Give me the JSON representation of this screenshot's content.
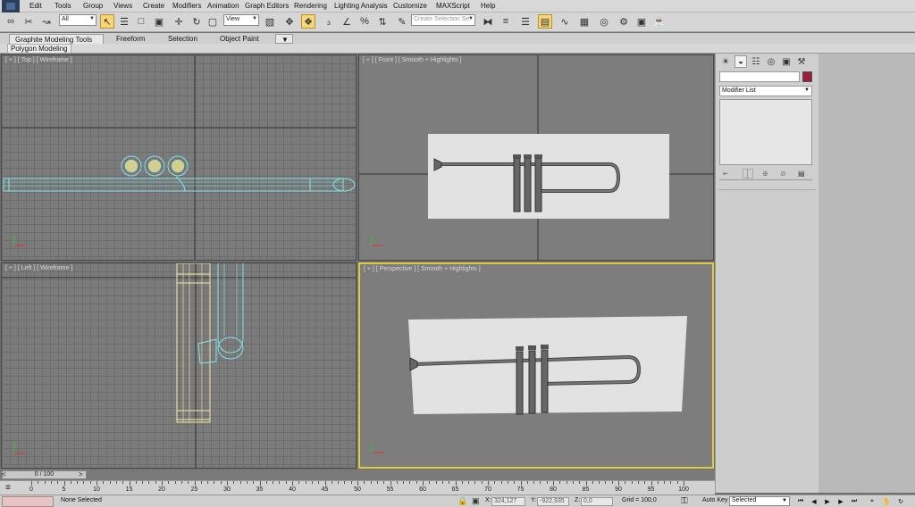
{
  "menu": {
    "items": [
      "Edit",
      "Tools",
      "Group",
      "Views",
      "Create",
      "Modifiers",
      "Animation",
      "Graph Editors",
      "Rendering",
      "Lighting Analysis",
      "Customize",
      "MAXScript",
      "Help"
    ]
  },
  "toolbar": {
    "filter_value": "All",
    "refcoord_value": "View",
    "selection_set_placeholder": "Create Selection Se",
    "icons": [
      "link-icon",
      "unlink-icon",
      "bind-spacewarp-icon",
      "select-object-icon",
      "select-by-name-icon",
      "rect-region-icon",
      "window-crossing-icon",
      "select-move-icon",
      "select-rotate-icon",
      "select-scale-icon",
      "pivot-icon",
      "manipulate-icon",
      "keyboard-shortcut-icon",
      "snap-3d-icon",
      "angle-snap-icon",
      "percent-snap-icon",
      "spinner-snap-icon",
      "edit-named-sel-icon",
      "mirror-icon",
      "align-icon",
      "layer-manager-icon",
      "graphite-toggle-icon",
      "curve-editor-icon",
      "schematic-view-icon",
      "material-editor-icon",
      "render-setup-icon",
      "rendered-frame-icon",
      "render-production-icon",
      "render-iterative-icon"
    ]
  },
  "ribbon": {
    "tabs": [
      "Graphite Modeling Tools",
      "Freeform",
      "Selection",
      "Object Paint"
    ],
    "active_tab": "Graphite Modeling Tools",
    "panel_label": "Polygon Modeling"
  },
  "viewports": {
    "top": {
      "label": "[ + ] [ Top ] [ Wireframe ]"
    },
    "front": {
      "label": "[ + ] [ Front ] [ Smooth + Highlights ]"
    },
    "left": {
      "label": "[ + ] [ Left ] [ Wireframe ]"
    },
    "perspective": {
      "label": "[ + ] [ Perspective ] [ Smooth + Highlights ]"
    }
  },
  "command_panel": {
    "tabs": [
      "create-icon",
      "modify-icon",
      "hierarchy-icon",
      "motion-icon",
      "display-icon",
      "utilities-icon"
    ],
    "name_value": "",
    "modifier_list_label": "Modifier List",
    "object_color": "#9c1c3e",
    "stack_buttons": [
      "pin-stack-icon",
      "show-end-result-icon",
      "make-unique-icon",
      "remove-modifier-icon",
      "configure-sets-icon"
    ]
  },
  "timeline": {
    "slider_label": "0 / 100",
    "ticks": [
      0,
      5,
      10,
      15,
      20,
      25,
      30,
      35,
      40,
      45,
      50,
      55,
      60,
      65,
      70,
      75,
      80,
      85,
      90,
      95,
      100
    ]
  },
  "status": {
    "selection_text": "None Selected",
    "x_label": "X:",
    "x_value": "324,127",
    "y_label": "Y:",
    "y_value": "-922,935",
    "z_label": "Z:",
    "z_value": "0,0",
    "grid_text": "Grid = 100,0",
    "auto_key_label": "Auto Key",
    "key_filter_value": "Selected",
    "playback_buttons": [
      "go-to-start-icon",
      "prev-frame-icon",
      "play-icon",
      "next-frame-icon",
      "go-to-end-icon"
    ]
  },
  "colors": {
    "wire_cyan": "#7fe6ec",
    "wire_yellow": "#f4e6a0",
    "active_viewport_border": "#e0cc3a",
    "selected_tool": "#f6d676"
  }
}
